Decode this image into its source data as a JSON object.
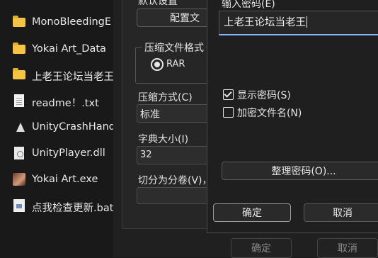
{
  "files": [
    {
      "name": "MonoBleedingE",
      "icon": "folder-icon"
    },
    {
      "name": "Yokai Art_Data",
      "icon": "folder-icon"
    },
    {
      "name": "上老王论坛当老王",
      "icon": "folder-icon"
    },
    {
      "name": "readme！.txt",
      "icon": "text-file-icon"
    },
    {
      "name": "UnityCrashHand",
      "icon": "unity-icon"
    },
    {
      "name": "UnityPlayer.dll",
      "icon": "dll-file-icon"
    },
    {
      "name": "Yokai Art.exe",
      "icon": "app-icon"
    },
    {
      "name": "点我检查更新.bat",
      "icon": "batch-file-icon"
    }
  ],
  "archive": {
    "default_settings_label": "默认设置",
    "config_button": "配置文",
    "format_group_label": "压缩文件格式",
    "format_option": "RAR",
    "method_label": "压缩方式(C)",
    "method_value": "标准",
    "dict_label": "字典大小(I)",
    "dict_value": "32",
    "split_label": "切分为分卷(V)，",
    "ok_button": "确定",
    "cancel_button": "取消"
  },
  "password": {
    "input_label": "输入密码(E)",
    "input_value": "上老王论坛当老王",
    "show_password_label": "显示密码(S)",
    "show_password_checked": true,
    "encrypt_names_label": "加密文件名(N)",
    "encrypt_names_checked": false,
    "organize_button": "整理密码(O)...",
    "ok_button": "确定",
    "cancel_button": "取消"
  }
}
